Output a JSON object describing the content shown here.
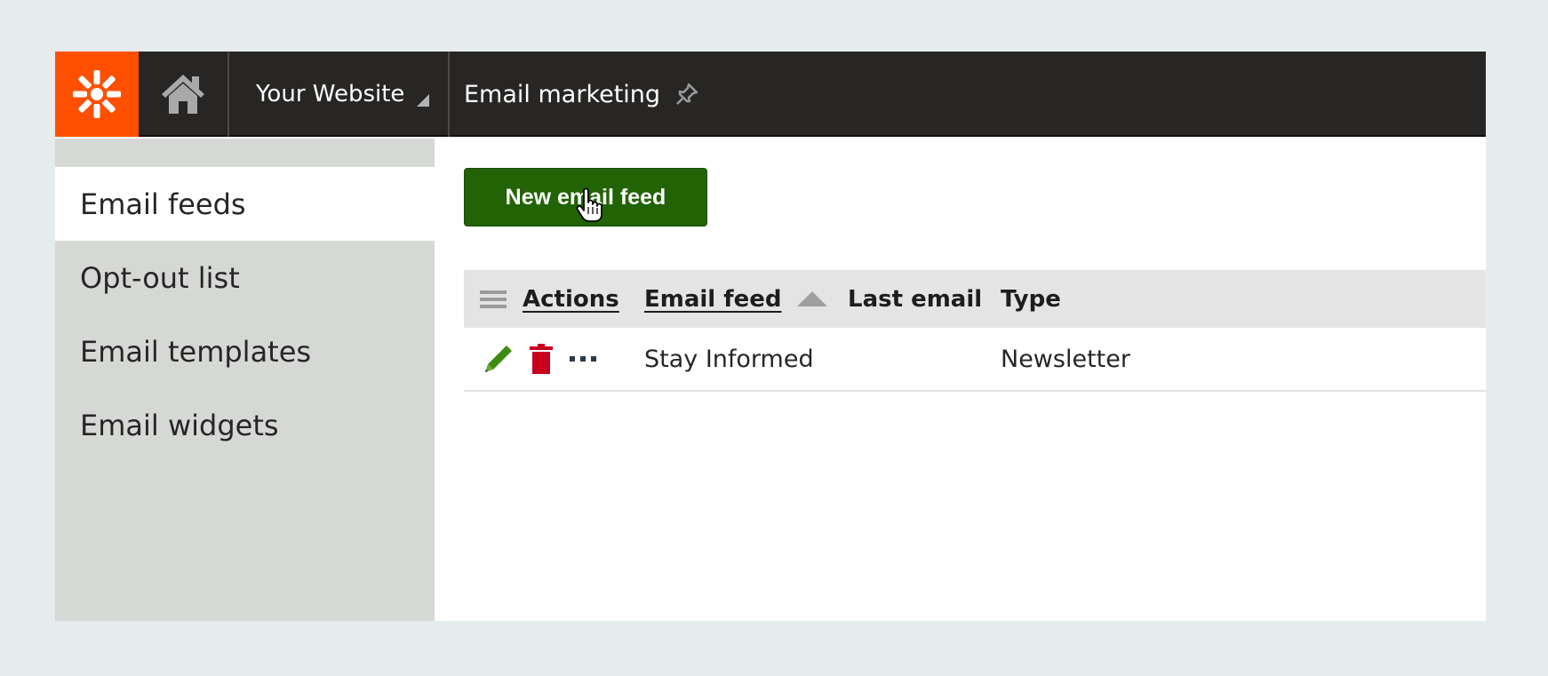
{
  "topbar": {
    "logo_icon": "kentico-logo-icon",
    "home_icon": "home-icon",
    "site_selector": {
      "label": "Your Website",
      "icon": "dropdown-triangle-icon"
    },
    "app_title": "Email marketing",
    "pin_icon": "pin-icon"
  },
  "colors": {
    "logo_bg": "#ff5000",
    "topbar_bg": "#272624",
    "primary_button": "#226305",
    "sidebar_bg": "#d6d8d5",
    "edit_icon": "#3d8c10",
    "delete_icon": "#c8001e"
  },
  "sidebar": {
    "items": [
      {
        "label": "Email feeds",
        "active": true
      },
      {
        "label": "Opt-out list",
        "active": false
      },
      {
        "label": "Email templates",
        "active": false
      },
      {
        "label": "Email widgets",
        "active": false
      }
    ]
  },
  "main": {
    "new_button_label": "New email feed",
    "grid": {
      "menu_icon": "hamburger-menu-icon",
      "columns": [
        {
          "label": "Actions",
          "sortable": true
        },
        {
          "label": "Email feed",
          "sortable": true,
          "sort": "ascending"
        },
        {
          "label": "Last email",
          "sortable": false
        },
        {
          "label": "Type",
          "sortable": false
        }
      ],
      "rows": [
        {
          "actions": [
            "edit-icon",
            "delete-icon",
            "more-icon"
          ],
          "email_feed": "Stay Informed",
          "last_email": "",
          "type": "Newsletter"
        }
      ]
    }
  }
}
